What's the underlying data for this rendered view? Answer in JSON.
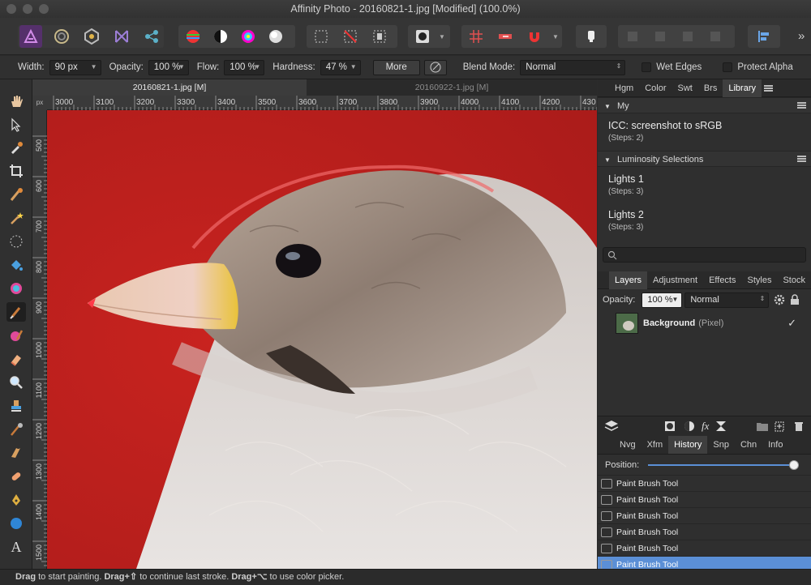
{
  "window": {
    "title": "Affinity Photo - 20160821-1.jpg [Modified] (100.0%)"
  },
  "toolbar": {
    "personas": [
      "photo-persona-icon",
      "liquify-persona-icon",
      "develop-persona-icon",
      "tone-mapping-persona-icon",
      "export-persona-icon"
    ],
    "more_label": "»"
  },
  "context": {
    "width_label": "Width:",
    "width_value": "90 px",
    "opacity_label": "Opacity:",
    "opacity_value": "100 %",
    "flow_label": "Flow:",
    "flow_value": "100 %",
    "hardness_label": "Hardness:",
    "hardness_value": "47 %",
    "more_button": "More",
    "blend_label": "Blend Mode:",
    "blend_value": "Normal",
    "wet_edges": "Wet Edges",
    "protect_alpha": "Protect Alpha"
  },
  "documents": {
    "tabs": [
      "20160821-1.jpg [M]",
      "20160922-1.jpg [M]"
    ]
  },
  "rulers": {
    "unit": "px",
    "horizontal": [
      "3000",
      "3100",
      "3200",
      "3300",
      "3400",
      "3500",
      "3600",
      "3700",
      "3800",
      "3900",
      "4000",
      "4100",
      "4200",
      "430"
    ],
    "vertical": [
      "500",
      "600",
      "700",
      "800",
      "900",
      "1000",
      "1100",
      "1200",
      "1300",
      "1400",
      "1500"
    ]
  },
  "status": {
    "drag": "Drag",
    "t1": " to start painting. ",
    "drag2": "Drag",
    "plus1": "+⇧",
    "t2": " to continue last stroke. ",
    "drag3": "Drag",
    "plus2": "+⌥",
    "t3": " to use color picker."
  },
  "library_panel": {
    "tabs": [
      "Hgm",
      "Color",
      "Swt",
      "Brs",
      "Library"
    ],
    "active_tab": "Library",
    "sections": [
      {
        "name": "My",
        "items": [
          {
            "title": "ICC: screenshot to sRGB",
            "steps": "(Steps: 2)"
          }
        ]
      },
      {
        "name": "Luminosity Selections",
        "items": [
          {
            "title": "Lights 1",
            "steps": "(Steps: 3)"
          },
          {
            "title": "Lights 2",
            "steps": "(Steps: 3)"
          }
        ]
      }
    ]
  },
  "layers_panel": {
    "tabs": [
      "Layers",
      "Adjustment",
      "Effects",
      "Styles",
      "Stock"
    ],
    "active_tab": "Layers",
    "opacity_label": "Opacity:",
    "opacity_value": "100 %",
    "blend_value": "Normal",
    "layer_name": "Background",
    "layer_type": "(Pixel)"
  },
  "history_panel": {
    "tabs": [
      "Nvg",
      "Xfm",
      "History",
      "Snp",
      "Chn",
      "Info"
    ],
    "active_tab": "History",
    "position_label": "Position:",
    "position_value": 1.0,
    "entries": [
      "Paint Brush Tool",
      "Paint Brush Tool",
      "Paint Brush Tool",
      "Paint Brush Tool",
      "Paint Brush Tool",
      "Paint Brush Tool"
    ]
  },
  "colors": {
    "accent": "#5b8fd6",
    "canvas_bg": "#b8201f"
  }
}
